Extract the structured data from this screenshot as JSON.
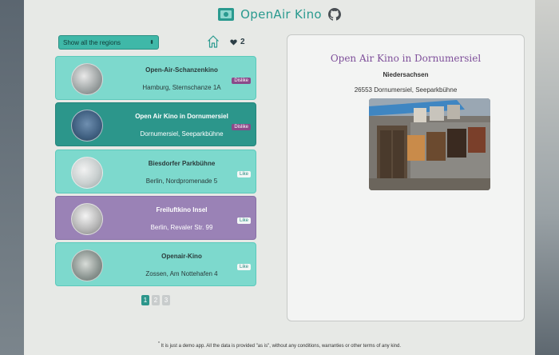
{
  "app": {
    "title": "OpenAir Kino",
    "favorites_count": "2"
  },
  "filter": {
    "selected": "Show all the regions"
  },
  "cinemas": [
    {
      "name": "Open-Air-Schanzenkino",
      "address": "Hamburg, Sternschanze 1A",
      "badge": "Dislike"
    },
    {
      "name": "Open Air Kino in Dornumersiel",
      "address": "Dornumersiel, Seeparkbühne",
      "badge": "Dislike"
    },
    {
      "name": "Biesdorfer Parkbühne",
      "address": "Berlin, Nordpromenade 5",
      "badge": "Like"
    },
    {
      "name": "Freiluftkino Insel",
      "address": "Berlin, Revaler Str. 99",
      "badge": "Like"
    },
    {
      "name": "Openair-Kino",
      "address": "Zossen, Am Nottehafen 4",
      "badge": "Like"
    }
  ],
  "pagination": {
    "pages": [
      "1",
      "2",
      "3"
    ],
    "current": "1"
  },
  "detail": {
    "title": "Open Air Kino in Dornumersiel",
    "region": "Niedersachsen",
    "address": "26553 Dornumersiel, Seeparkbühne"
  },
  "footer": {
    "mark": "*",
    "note": "It is just a demo app. All the data is provided \"as is\", without any conditions, warranties or other terms of any kind."
  },
  "colors": {
    "accent": "#2a9a8f",
    "card_light": "#7dd9cd",
    "card_selected": "#2c968b",
    "card_purple": "#9a82b6",
    "detail_title": "#7e4f9a"
  },
  "icons": {
    "logo": "film-icon",
    "github": "github-icon",
    "home": "home-icon",
    "favorites": "heart-icon"
  }
}
